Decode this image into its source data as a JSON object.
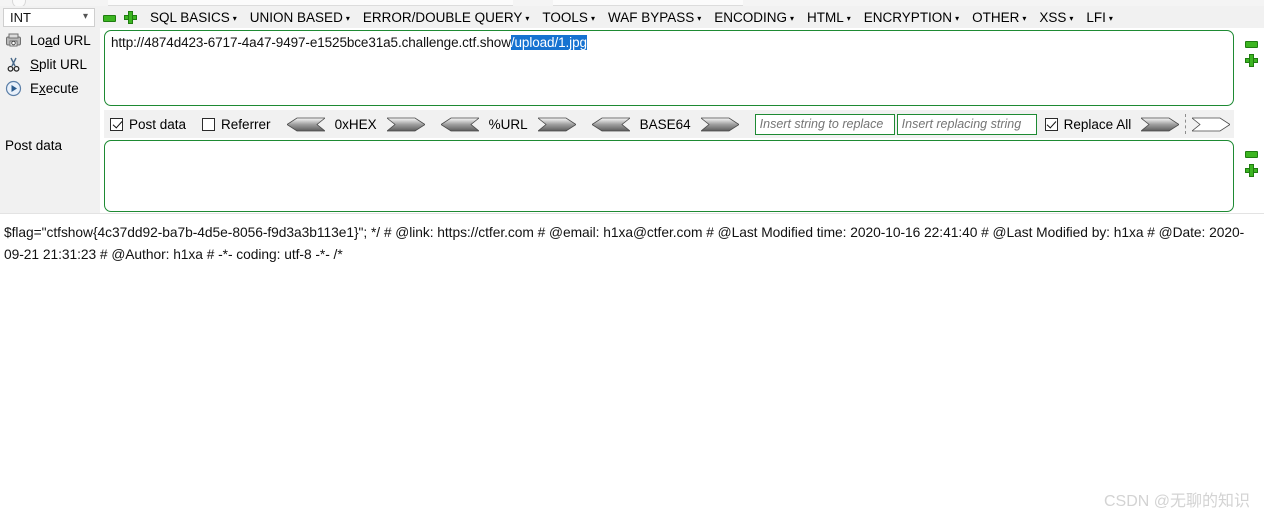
{
  "app": {
    "type_selector": {
      "value": "INT",
      "chevron_icon": "chevron-down-icon"
    },
    "menu_items": [
      {
        "label": "SQL BASICS",
        "caret": "▾"
      },
      {
        "label": "UNION BASED",
        "caret": "▾"
      },
      {
        "label": "ERROR/DOUBLE QUERY",
        "caret": "▾"
      },
      {
        "label": "TOOLS",
        "caret": "▾"
      },
      {
        "label": "WAF BYPASS",
        "caret": "▾"
      },
      {
        "label": "ENCODING",
        "caret": "▾"
      },
      {
        "label": "HTML",
        "caret": "▾"
      },
      {
        "label": "ENCRYPTION",
        "caret": "▾"
      },
      {
        "label": "OTHER",
        "caret": "▾"
      },
      {
        "label": "XSS",
        "caret": "▾"
      },
      {
        "label": "LFI",
        "caret": "▾"
      }
    ]
  },
  "actions": [
    {
      "label_pre": "Lo",
      "label_accel": "a",
      "label_post": "d URL",
      "icon": "load-url-icon"
    },
    {
      "label_pre": "",
      "label_accel": "S",
      "label_post": "plit URL",
      "icon": "scissors-icon"
    },
    {
      "label_pre": "E",
      "label_accel": "x",
      "label_post": "ecute",
      "icon": "play-circle-icon"
    }
  ],
  "post_data_label": "Post data",
  "url_field": {
    "text": "http://4874d423-6717-4a47-9497-e1525bce31a5.challenge.ctf.show",
    "selected_text": "/upload/1.jpg"
  },
  "post_data_field": {
    "value": ""
  },
  "options": {
    "post_data": {
      "label": "Post data",
      "checked": true
    },
    "referrer": {
      "label": "Referrer",
      "checked": false
    },
    "hex": {
      "label": "0xHEX"
    },
    "url_enc": {
      "label": "%URL"
    },
    "base64": {
      "label": "BASE64"
    },
    "replace_search": {
      "placeholder": "Insert string to replace",
      "value": ""
    },
    "replace_with": {
      "placeholder": "Insert replacing string",
      "value": ""
    },
    "replace_all": {
      "label": "Replace All",
      "checked": true
    }
  },
  "side_controls": {
    "minus_icon": "minus-icon",
    "plus_icon": "plus-icon"
  },
  "output": {
    "text": "$flag=\"ctfshow{4c37dd92-ba7b-4d5e-8056-f9d3a3b113e1}\"; */ # @link: https://ctfer.com # @email: h1xa@ctfer.com # @Last Modified time: 2020-10-16 22:41:40 # @Last Modified by: h1xa # @Date: 2020-09-21 21:31:23 # @Author: h1xa # -*- coding: utf-8 -*- /*"
  },
  "watermark": {
    "text": "CSDN @无聊的知识"
  },
  "colors": {
    "accent_green": "#1e8a33",
    "icon_green": "#3cb521",
    "selection_blue": "#1673d1",
    "toolbar_bg": "#f1f1f1"
  }
}
